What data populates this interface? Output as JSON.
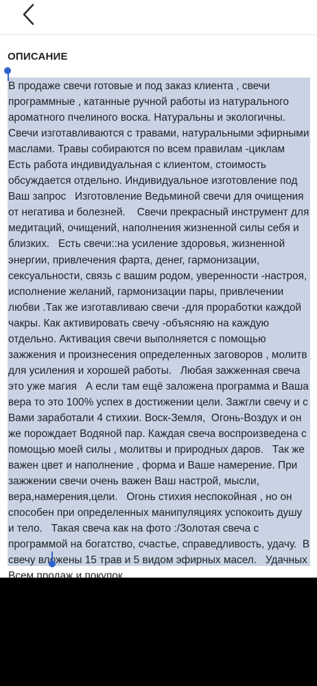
{
  "header": {
    "back_icon": "chevron-left-icon"
  },
  "section": {
    "title": "ОПИСАНИЕ"
  },
  "description": {
    "text": "В продаже свечи готовые и под заказ клиента , свечи программные , катанные ручной работы из натурального ароматного пчелиного воска. Натуральны и экологичны. Свечи изготавливаются с травами, натуральными эфирными маслами. Травы собираются по всем правилам -циклам   Есть работа индивидуальная с клиентом, стоимость обсуждается отдельно. Индивидуальное изготовление под Ваш запрос   Изготовление Ведьминой свечи для очищения от негатива и болезней.    Свечи прекрасный инструмент для медитаций, очищений, наполнения жизненной силы себя и близких.   Есть свечи::на усиление здоровья, жизненной энергии, привлечения фарта, денег, гармонизации, сексуальности, связь с вашим родом, уверенности -настроя, исполнение желаний, гармонизации пары, привлечении любви .Так же изготавливаю свечи -для проработки каждой чакры. Как активировать свечу -объясняю на каждую отдельно. Активация свечи выполняется с помощью зажжения и произнесения определенных заговоров , молитв для усиления и хорошей работы.   Любая зажженная свеча это уже магия   А если там ещё заложена программа и Ваша вера то это 100% успех в достижении цели. Зажгли свечу и с Вами заработали 4 стихии. Воск-Земля,  Огонь-Воздух и он же порождает Водяной пар. Каждая свеча воспроизведена с помощью моей силы , молитвы и природных даров.   Так же важен цвет и наполнение , форма и Ваше намерение. При зажжении свечи очень важен Ваш настрой, мысли, вера,намерения,цели.   Огонь стихия неспокойная , но он способен при определенных манипуляциях успокоить душу и тело.   Такая свеча как на фото :/Золотая свеча с программой на богатство, счастье, справедливость, удачу.  В свечу вложены 15 трав и 5 видом эфирных масел.   Удачных Всем продаж и покупок"
  },
  "colors": {
    "selection_highlight": "#c9d3e3",
    "selection_handle": "#2f63cc",
    "text": "#1f2126",
    "background": "#ffffff",
    "bottom_area": "#000000"
  }
}
